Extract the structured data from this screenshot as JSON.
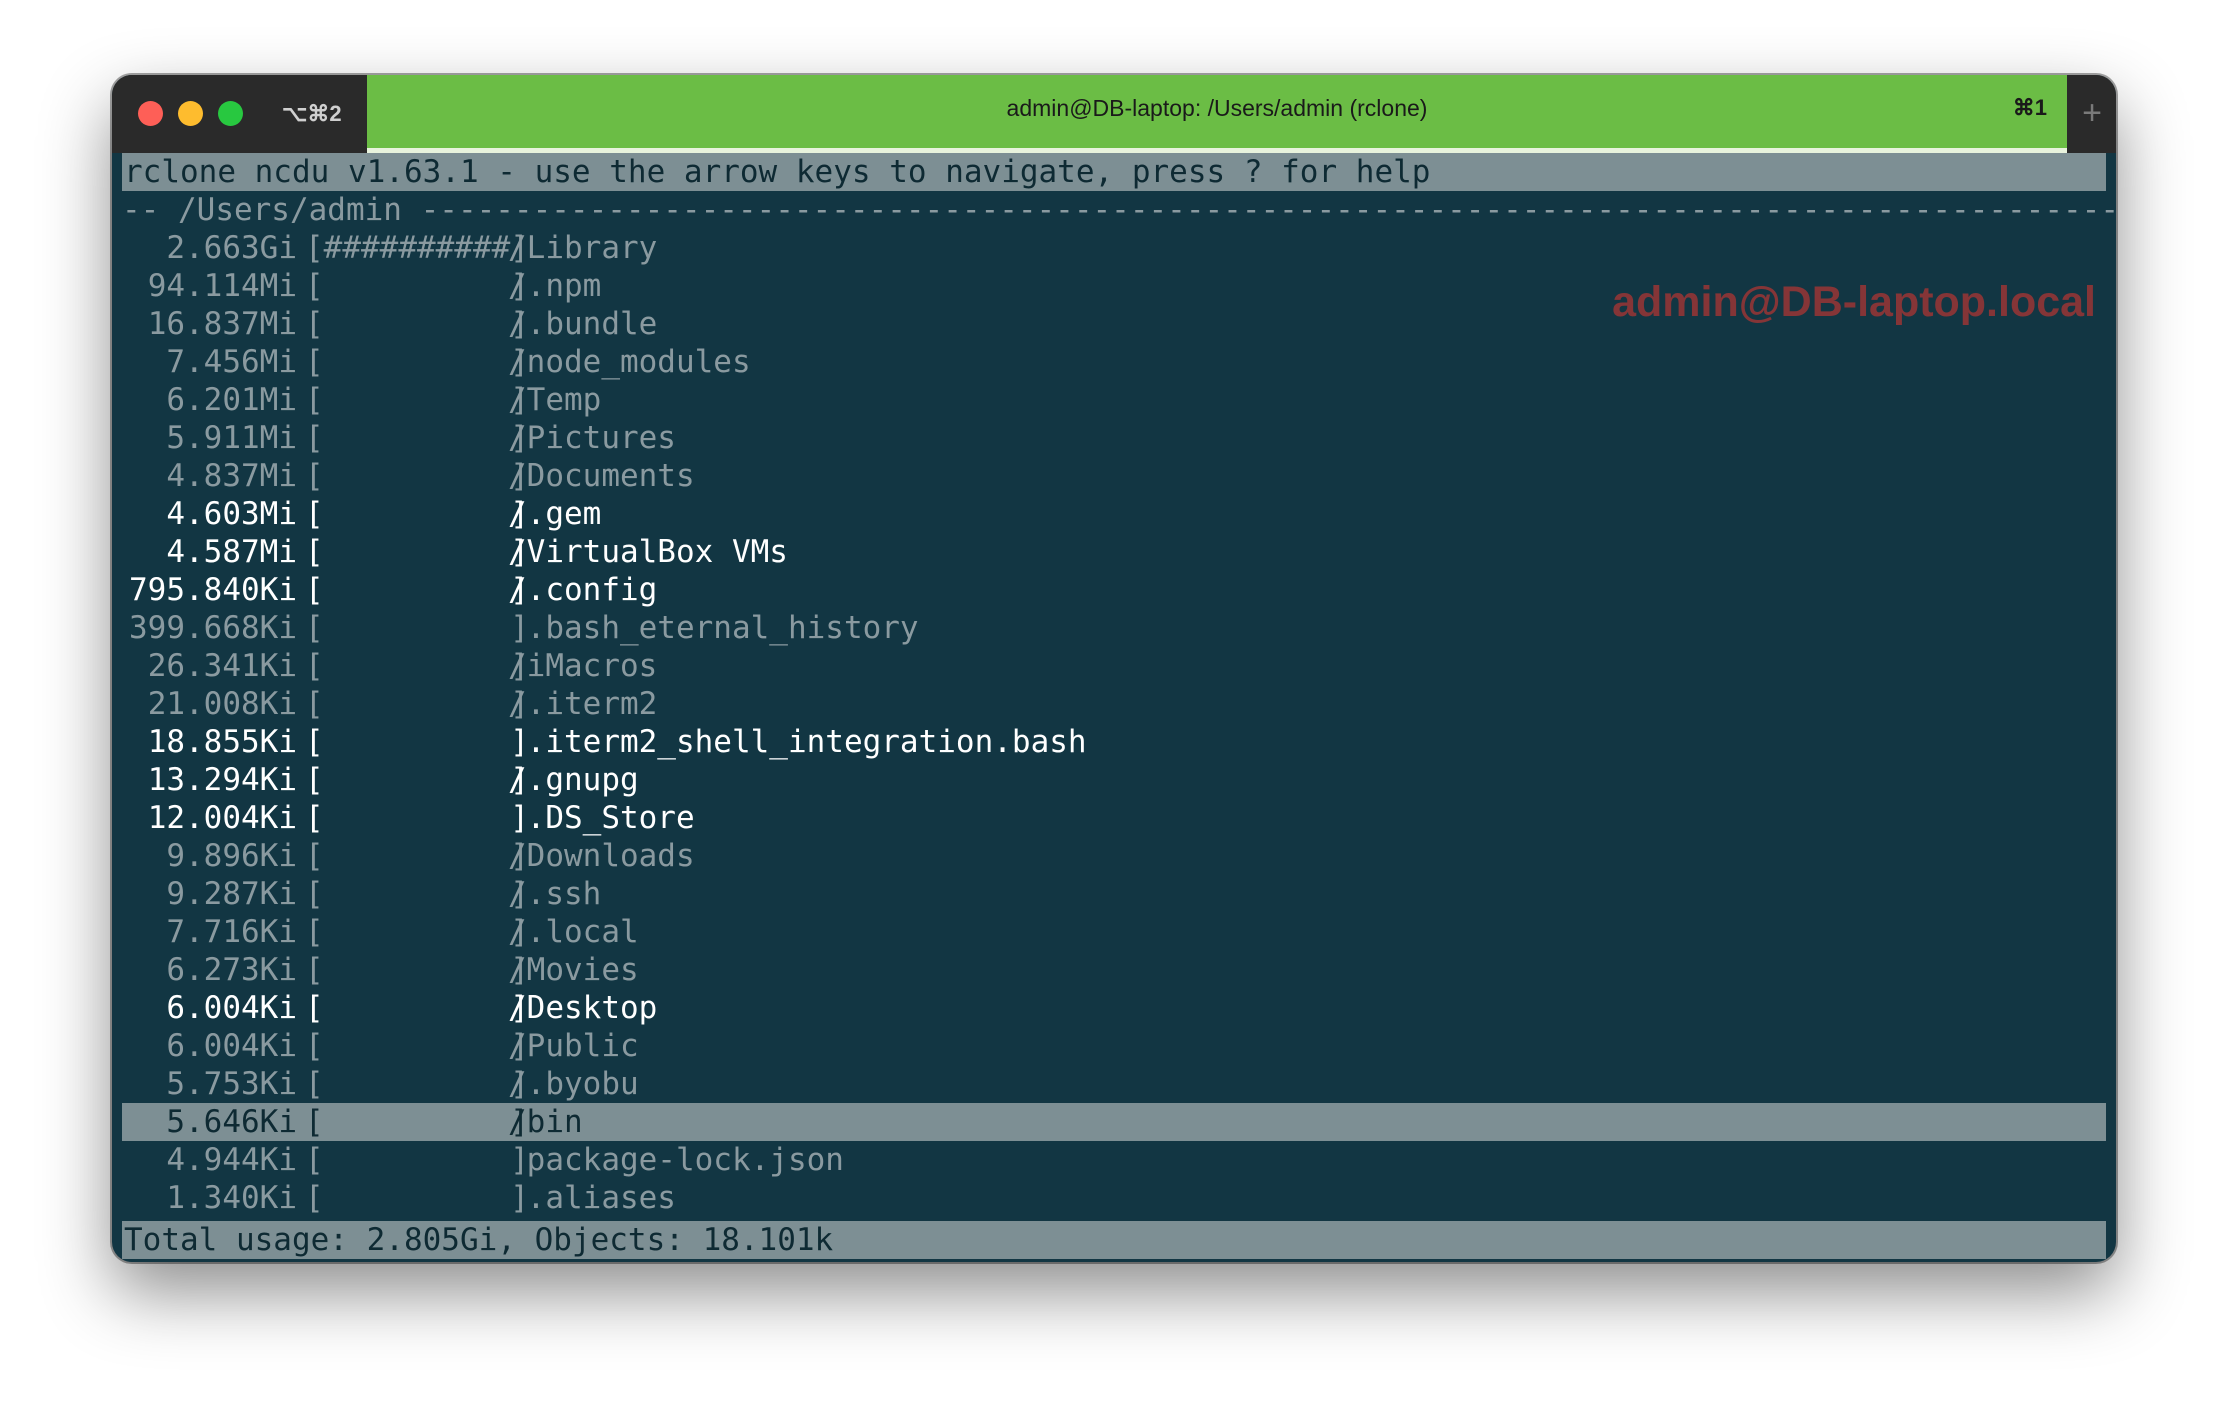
{
  "window": {
    "left_tab_shortcut": "⌥⌘2",
    "title": "admin@DB-laptop: /Users/admin (rclone)",
    "tab_shortcut": "⌘1",
    "new_tab_icon": "plus-icon"
  },
  "terminal": {
    "header": "rclone ncdu v1.63.1 - use the arrow keys to navigate, press ? for help",
    "path_line": "-- /Users/admin ------------------------------------------------------------------------------------------------------------",
    "watermark": "admin@DB-laptop.local",
    "rows": [
      {
        "size": "2.663Gi",
        "bar": "[##########]",
        "name": "/Library",
        "style": "dim"
      },
      {
        "size": "94.114Mi",
        "bar": "[          ]",
        "name": "/.npm",
        "style": "dim"
      },
      {
        "size": "16.837Mi",
        "bar": "[          ]",
        "name": "/.bundle",
        "style": "dim"
      },
      {
        "size": "7.456Mi",
        "bar": "[          ]",
        "name": "/node_modules",
        "style": "dim"
      },
      {
        "size": "6.201Mi",
        "bar": "[          ]",
        "name": "/Temp",
        "style": "dim"
      },
      {
        "size": "5.911Mi",
        "bar": "[          ]",
        "name": "/Pictures",
        "style": "dim"
      },
      {
        "size": "4.837Mi",
        "bar": "[          ]",
        "name": "/Documents",
        "style": "dim"
      },
      {
        "size": "4.603Mi",
        "bar": "[          ]",
        "name": "/.gem",
        "style": "bright"
      },
      {
        "size": "4.587Mi",
        "bar": "[          ]",
        "name": "/VirtualBox VMs",
        "style": "bright"
      },
      {
        "size": "795.840Ki",
        "bar": "[          ]",
        "name": "/.config",
        "style": "bright"
      },
      {
        "size": "399.668Ki",
        "bar": "[          ]",
        "name": " .bash_eternal_history",
        "style": "dim"
      },
      {
        "size": "26.341Ki",
        "bar": "[          ]",
        "name": "/iMacros",
        "style": "dim"
      },
      {
        "size": "21.008Ki",
        "bar": "[          ]",
        "name": "/.iterm2",
        "style": "dim"
      },
      {
        "size": "18.855Ki",
        "bar": "[          ]",
        "name": " .iterm2_shell_integration.bash",
        "style": "bright"
      },
      {
        "size": "13.294Ki",
        "bar": "[          ]",
        "name": "/.gnupg",
        "style": "bright"
      },
      {
        "size": "12.004Ki",
        "bar": "[          ]",
        "name": " .DS_Store",
        "style": "bright"
      },
      {
        "size": "9.896Ki",
        "bar": "[          ]",
        "name": "/Downloads",
        "style": "dim"
      },
      {
        "size": "9.287Ki",
        "bar": "[          ]",
        "name": "/.ssh",
        "style": "dim"
      },
      {
        "size": "7.716Ki",
        "bar": "[          ]",
        "name": "/.local",
        "style": "dim"
      },
      {
        "size": "6.273Ki",
        "bar": "[          ]",
        "name": "/Movies",
        "style": "dim"
      },
      {
        "size": "6.004Ki",
        "bar": "[          ]",
        "name": "/Desktop",
        "style": "bright"
      },
      {
        "size": "6.004Ki",
        "bar": "[          ]",
        "name": "/Public",
        "style": "dim"
      },
      {
        "size": "5.753Ki",
        "bar": "[          ]",
        "name": "/.byobu",
        "style": "dim"
      },
      {
        "size": "5.646Ki",
        "bar": "[          ]",
        "name": "/bin",
        "style": "selected"
      },
      {
        "size": "4.944Ki",
        "bar": "[          ]",
        "name": " package-lock.json",
        "style": "dim"
      },
      {
        "size": "1.340Ki",
        "bar": "[          ]",
        "name": " .aliases",
        "style": "dim"
      }
    ],
    "footer": "Total usage: 2.805Gi, Objects: 18.101k"
  },
  "colors": {
    "terminal_bg": "#123643",
    "tab_active": "#6bbd45",
    "bar_bg": "#7d8f94",
    "text_dim": "#8a9aa0",
    "text_bright": "#ffffff",
    "watermark": "#9a3535"
  }
}
